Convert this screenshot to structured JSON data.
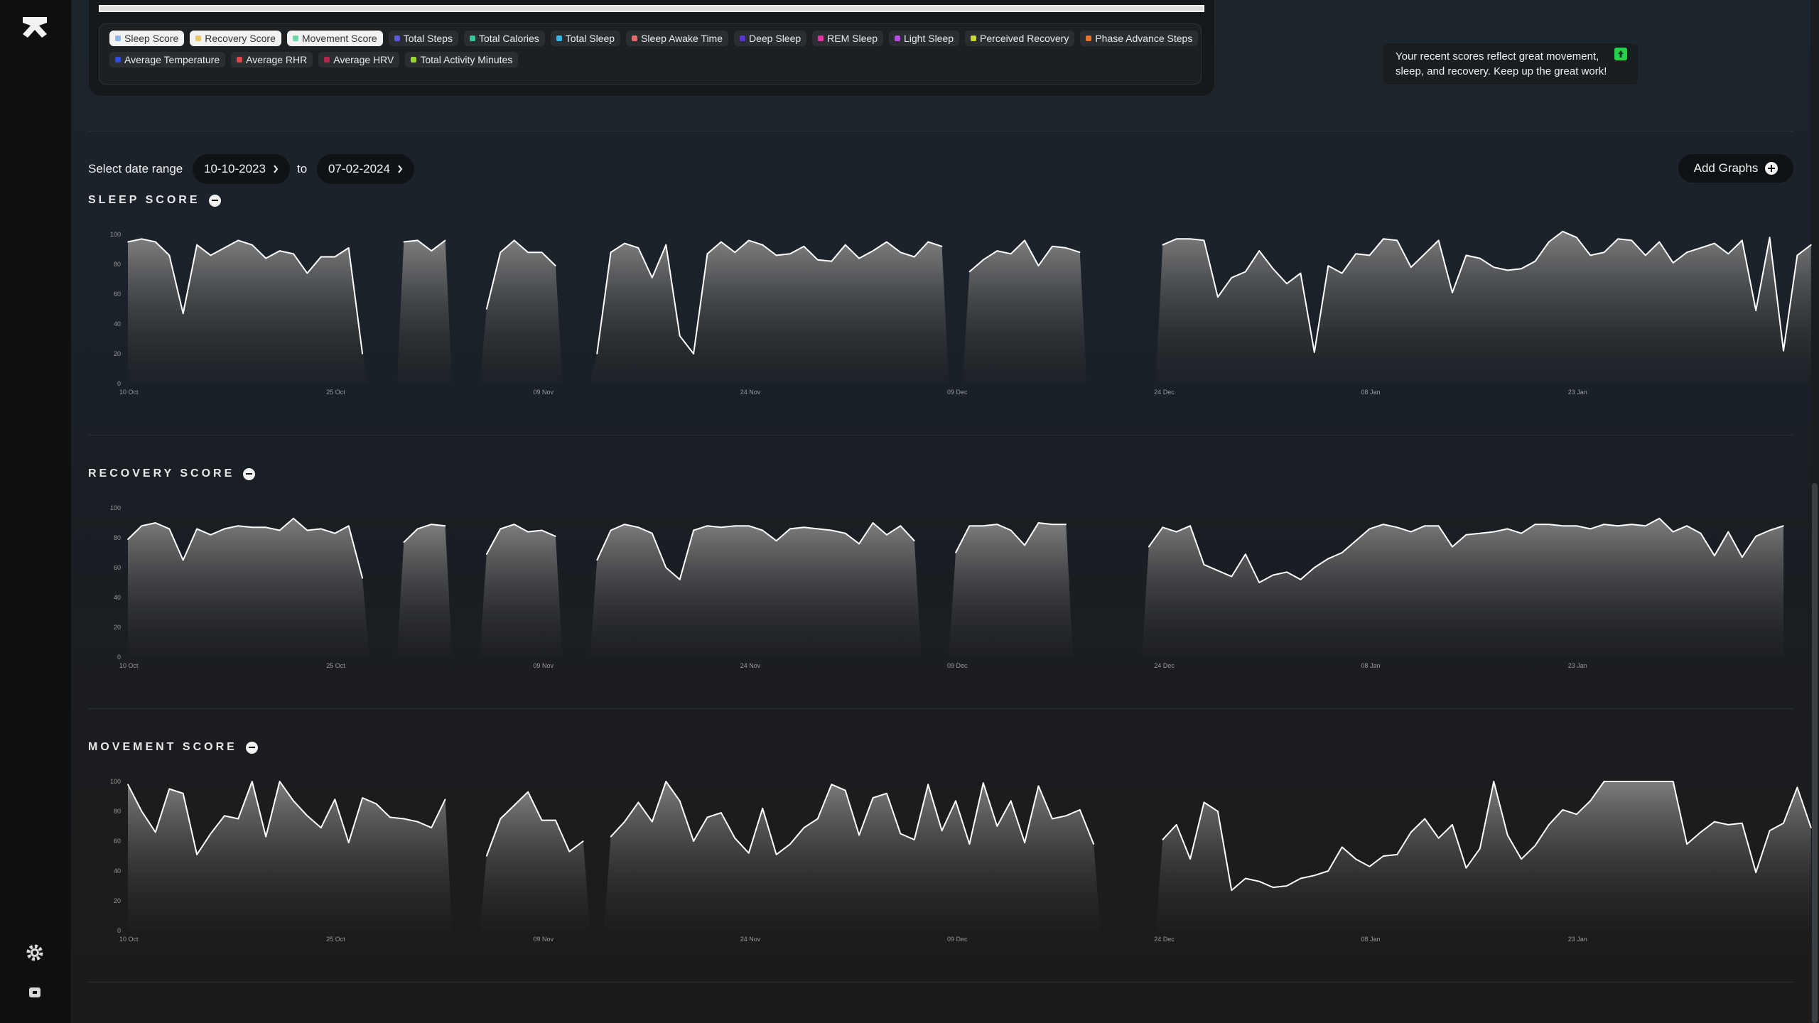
{
  "legend": {
    "row1": [
      {
        "label": "Sleep Score",
        "color": "#8fb8e6",
        "active": true
      },
      {
        "label": "Recovery Score",
        "color": "#e6c86a",
        "active": true
      },
      {
        "label": "Movement Score",
        "color": "#6fd6a8",
        "active": true
      },
      {
        "label": "Total Steps",
        "color": "#5a5ad6",
        "active": false
      },
      {
        "label": "Total Calories",
        "color": "#35c79a",
        "active": false
      },
      {
        "label": "Total Sleep",
        "color": "#33b8e6",
        "active": false
      },
      {
        "label": "Sleep Awake Time",
        "color": "#e66a6a",
        "active": false
      },
      {
        "label": "Deep Sleep",
        "color": "#5a33d6",
        "active": false
      },
      {
        "label": "REM Sleep",
        "color": "#e633a3",
        "active": false
      },
      {
        "label": "Light Sleep",
        "color": "#b84de6",
        "active": false
      },
      {
        "label": "Perceived Recovery",
        "color": "#c9d633",
        "active": false
      },
      {
        "label": "Phase Advance Steps",
        "color": "#e6732e",
        "active": false
      }
    ],
    "row2": [
      {
        "label": "Average Temperature",
        "color": "#2d4de0",
        "active": false
      },
      {
        "label": "Average RHR",
        "color": "#e04545",
        "active": false
      },
      {
        "label": "Average HRV",
        "color": "#b8264d",
        "active": false
      },
      {
        "label": "Total Activity Minutes",
        "color": "#9ad633",
        "active": false
      }
    ]
  },
  "message": {
    "text": "Your recent scores reflect great movement, sleep, and recovery. Keep up the great work!",
    "icon": "trend-up-icon",
    "icon_color": "#25d04a"
  },
  "date_range": {
    "label": "Select date range",
    "start": "10-10-2023",
    "to_label": "to",
    "end": "07-02-2024"
  },
  "add_graphs_label": "Add Graphs",
  "chart_data": [
    {
      "type": "area",
      "title": "SLEEP SCORE",
      "ylim": [
        0,
        100
      ],
      "yticks": [
        0,
        20,
        40,
        60,
        80,
        100
      ],
      "xticks": [
        {
          "label": "10 Oct",
          "index": 0
        },
        {
          "label": "25 Oct",
          "index": 15
        },
        {
          "label": "09 Nov",
          "index": 30
        },
        {
          "label": "24 Nov",
          "index": 45
        },
        {
          "label": "09 Dec",
          "index": 60
        },
        {
          "label": "24 Dec",
          "index": 75
        },
        {
          "label": "08 Jan",
          "index": 90
        },
        {
          "label": "23 Jan",
          "index": 105
        }
      ],
      "n_points": 121,
      "values": [
        95,
        97,
        95,
        86,
        47,
        93,
        86,
        91,
        96,
        93,
        84,
        89,
        87,
        74,
        85,
        85,
        91,
        20,
        null,
        null,
        95,
        96,
        89,
        96,
        null,
        null,
        50,
        88,
        96,
        88,
        88,
        79,
        null,
        null,
        20,
        88,
        94,
        91,
        71,
        93,
        32,
        20,
        87,
        95,
        88,
        96,
        93,
        86,
        87,
        92,
        83,
        82,
        93,
        84,
        89,
        95,
        88,
        85,
        95,
        92,
        null,
        75,
        83,
        89,
        87,
        96,
        79,
        92,
        91,
        88,
        null,
        null,
        null,
        null,
        null,
        93,
        97,
        97,
        96,
        58,
        71,
        75,
        89,
        77,
        67,
        74,
        21,
        79,
        74,
        87,
        86,
        97,
        96,
        78,
        87,
        96,
        61,
        86,
        84,
        78,
        76,
        77,
        82,
        95,
        102,
        98,
        86,
        88,
        97,
        96,
        86,
        95,
        81,
        88,
        91,
        94,
        87,
        96,
        49,
        98,
        22,
        86,
        93
      ]
    },
    {
      "type": "area",
      "title": "RECOVERY SCORE",
      "ylim": [
        0,
        100
      ],
      "yticks": [
        0,
        20,
        40,
        60,
        80,
        100
      ],
      "xticks": [
        {
          "label": "10 Oct",
          "index": 0
        },
        {
          "label": "25 Oct",
          "index": 15
        },
        {
          "label": "09 Nov",
          "index": 30
        },
        {
          "label": "24 Nov",
          "index": 45
        },
        {
          "label": "09 Dec",
          "index": 60
        },
        {
          "label": "24 Dec",
          "index": 75
        },
        {
          "label": "08 Jan",
          "index": 90
        },
        {
          "label": "23 Jan",
          "index": 105
        }
      ],
      "n_points": 121,
      "values": [
        79,
        88,
        90,
        86,
        65,
        86,
        82,
        86,
        88,
        87,
        87,
        85,
        93,
        85,
        86,
        83,
        88,
        53,
        null,
        null,
        77,
        86,
        89,
        88,
        null,
        null,
        69,
        86,
        89,
        84,
        85,
        81,
        null,
        null,
        65,
        85,
        89,
        87,
        83,
        60,
        52,
        85,
        88,
        87,
        88,
        88,
        85,
        78,
        86,
        87,
        86,
        85,
        83,
        76,
        90,
        82,
        88,
        78,
        null,
        null,
        70,
        88,
        88,
        89,
        85,
        75,
        90,
        89,
        89,
        null,
        null,
        null,
        null,
        null,
        74,
        87,
        84,
        88,
        62,
        58,
        54,
        69,
        50,
        55,
        57,
        52,
        60,
        66,
        70,
        78,
        86,
        89,
        87,
        84,
        88,
        88,
        74,
        82,
        83,
        84,
        86,
        83,
        89,
        89,
        88,
        88,
        86,
        89,
        88,
        89,
        88,
        93,
        84,
        88,
        83,
        68,
        84,
        67,
        81,
        85,
        88
      ]
    },
    {
      "type": "area",
      "title": "MOVEMENT SCORE",
      "ylim": [
        0,
        100
      ],
      "yticks": [
        0,
        20,
        40,
        60,
        80,
        100
      ],
      "xticks": [
        {
          "label": "10 Oct",
          "index": 0
        },
        {
          "label": "25 Oct",
          "index": 15
        },
        {
          "label": "09 Nov",
          "index": 30
        },
        {
          "label": "24 Nov",
          "index": 45
        },
        {
          "label": "09 Dec",
          "index": 60
        },
        {
          "label": "24 Dec",
          "index": 75
        },
        {
          "label": "08 Jan",
          "index": 90
        },
        {
          "label": "23 Jan",
          "index": 105
        }
      ],
      "n_points": 121,
      "values": [
        98,
        80,
        66,
        95,
        92,
        51,
        65,
        77,
        75,
        100,
        63,
        100,
        87,
        77,
        69,
        88,
        59,
        89,
        85,
        76,
        75,
        73,
        69,
        88,
        null,
        null,
        50,
        75,
        84,
        93,
        74,
        74,
        53,
        60,
        null,
        63,
        73,
        86,
        73,
        100,
        87,
        60,
        76,
        79,
        62,
        52,
        82,
        51,
        58,
        69,
        75,
        98,
        94,
        64,
        89,
        92,
        65,
        61,
        98,
        67,
        87,
        58,
        99,
        70,
        87,
        59,
        97,
        75,
        77,
        81,
        58,
        null,
        null,
        null,
        null,
        61,
        71,
        48,
        86,
        80,
        27,
        35,
        33,
        29,
        30,
        35,
        37,
        40,
        56,
        48,
        43,
        50,
        51,
        66,
        75,
        62,
        71,
        42,
        55,
        100,
        64,
        48,
        57,
        71,
        81,
        78,
        87,
        100,
        100,
        100,
        100,
        100,
        100,
        58,
        66,
        73,
        71,
        72,
        39,
        67,
        72,
        96,
        69
      ]
    }
  ]
}
